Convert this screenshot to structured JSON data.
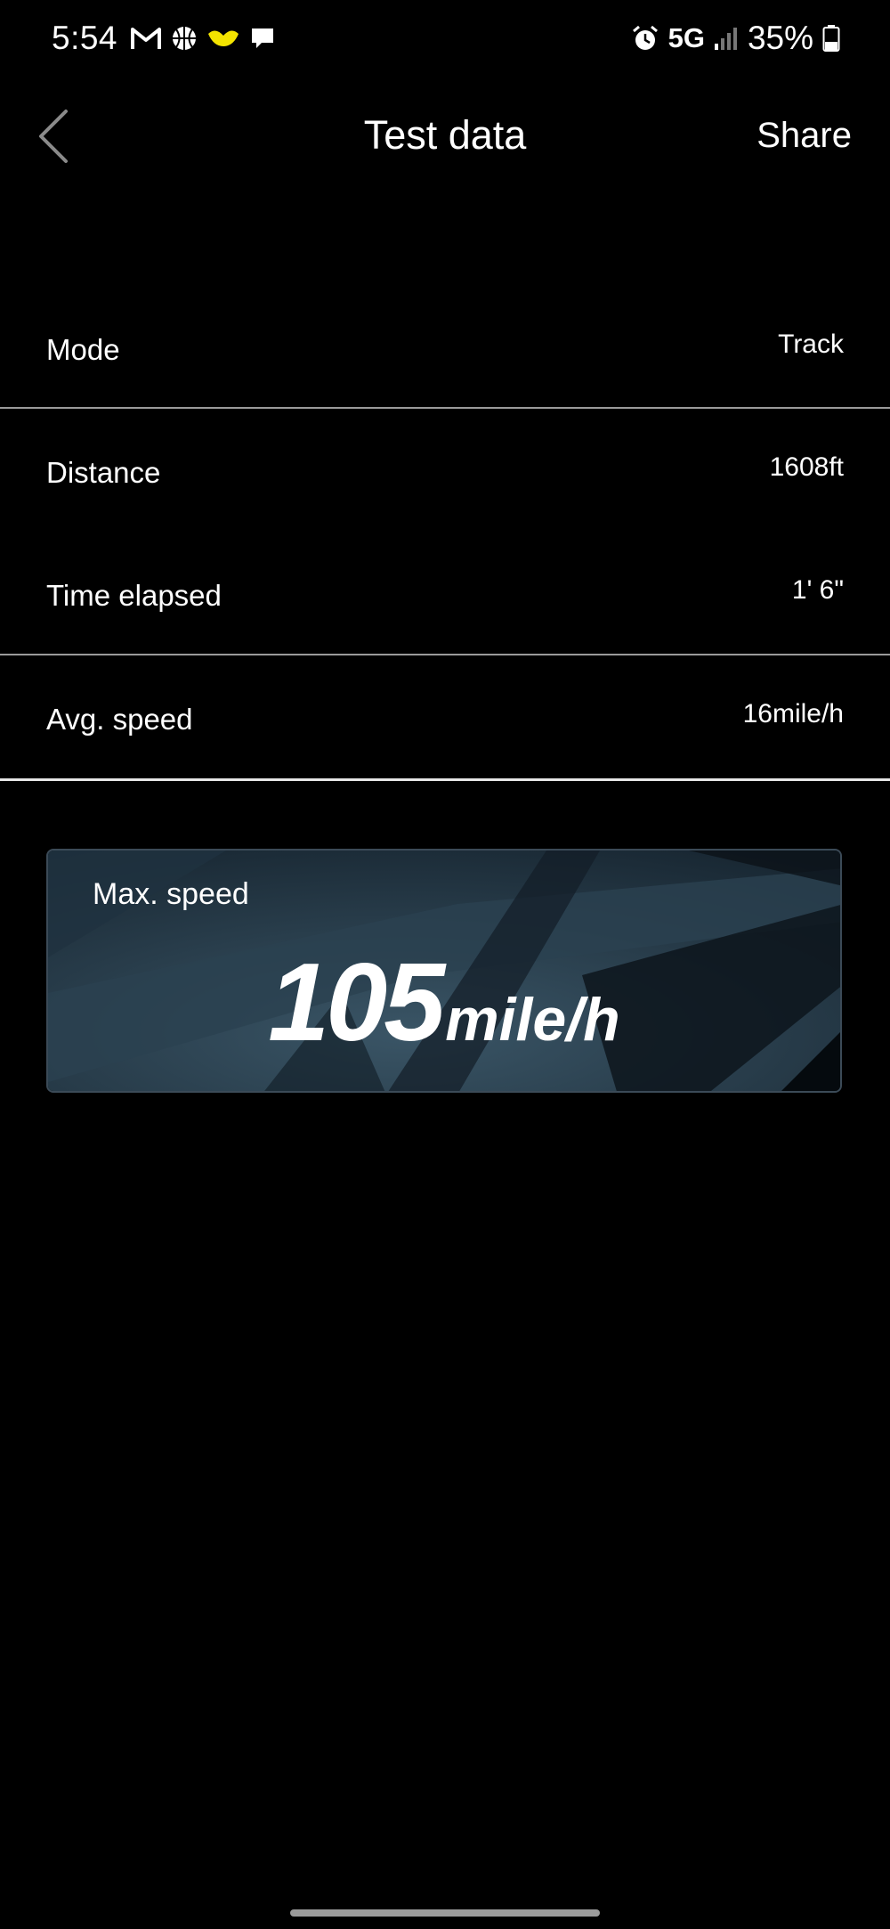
{
  "status_bar": {
    "time": "5:54",
    "network": "5G",
    "battery": "35%",
    "icons_left": [
      "gmail-icon",
      "basketball-icon",
      "heart-band-icon",
      "chat-icon"
    ],
    "icons_right": [
      "alarm-icon",
      "signal-icon",
      "battery-icon"
    ]
  },
  "header": {
    "title": "Test data",
    "share_label": "Share"
  },
  "rows": [
    {
      "label": "Mode",
      "value": "Track"
    },
    {
      "label": "Distance",
      "value": "1608ft"
    },
    {
      "label": "Time elapsed",
      "value": "1' 6\""
    },
    {
      "label": "Avg. speed",
      "value": "16mile/h"
    }
  ],
  "max_speed": {
    "label": "Max. speed",
    "value": "105",
    "unit": "mile/h"
  },
  "colors": {
    "background": "#000000",
    "text": "#ffffff",
    "divider": "#9a9a9a",
    "card_bg": "#1d2f3d"
  }
}
